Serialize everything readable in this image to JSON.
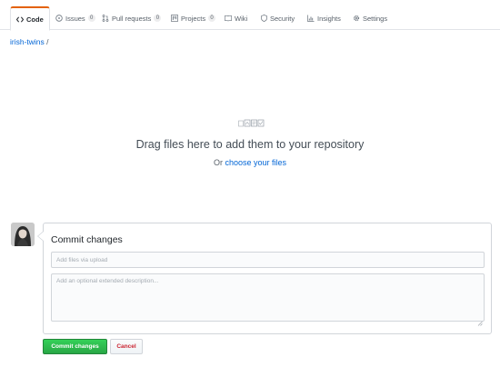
{
  "tabs": [
    {
      "label": "Code",
      "icon": "code-icon",
      "selected": true
    },
    {
      "label": "Issues",
      "icon": "issue-icon",
      "count": "0"
    },
    {
      "label": "Pull requests",
      "icon": "pull-request-icon",
      "count": "0"
    },
    {
      "label": "Projects",
      "icon": "project-icon",
      "count": "0"
    },
    {
      "label": "Wiki",
      "icon": "book-icon"
    },
    {
      "label": "Security",
      "icon": "shield-icon"
    },
    {
      "label": "Insights",
      "icon": "graph-icon"
    },
    {
      "label": "Settings",
      "icon": "gear-icon"
    }
  ],
  "breadcrumb": {
    "repo": "irish-twins",
    "separator": "/"
  },
  "dropzone": {
    "heading": "Drag files here to add them to your repository",
    "prefix": "Or",
    "link": "choose your files",
    "icon": "file-types-icon"
  },
  "commit": {
    "title": "Commit changes",
    "summary_placeholder": "Add files via upload",
    "summary_value": "",
    "description_placeholder": "Add an optional extended description...",
    "description_value": ""
  },
  "buttons": {
    "commit": "Commit changes",
    "cancel": "Cancel"
  },
  "colors": {
    "accent": "#e36209",
    "link": "#0366d6",
    "commit_button": "#28a745",
    "cancel_text": "#cb2431",
    "border": "#d1d5da"
  }
}
